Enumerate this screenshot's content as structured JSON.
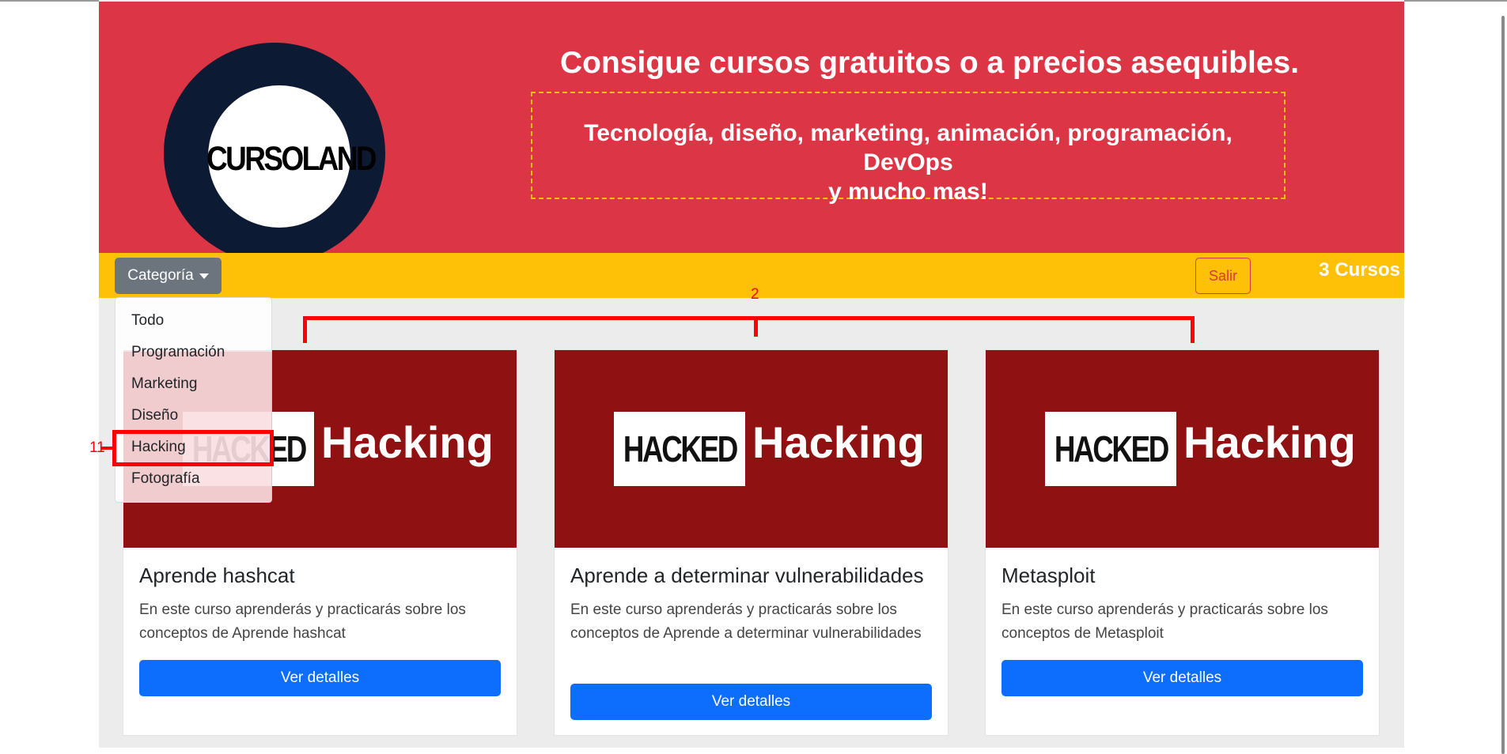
{
  "header": {
    "logo_text": "CURSOLAND",
    "title": "Consigue cursos gratuitos o a precios asequibles.",
    "subtitle_line1": "Tecnología, diseño, marketing, animación, programación, DevOps",
    "subtitle_line2": "y mucho mas!"
  },
  "navbar": {
    "category_label": "Categoría",
    "logout_label": "Salir",
    "count_label": "3 Cursos"
  },
  "dropdown": {
    "items": [
      "Todo",
      "Programación",
      "Marketing",
      "Diseño",
      "Hacking",
      "Fotografía"
    ]
  },
  "cards": [
    {
      "image_text_1": "HACKED",
      "image_text_2": "Hacking",
      "title": "Aprende hashcat",
      "description": "En este curso aprenderás y practicarás sobre los conceptos de Aprende hashcat",
      "button": "Ver detalles"
    },
    {
      "image_text_1": "HACKED",
      "image_text_2": "Hacking",
      "title": "Aprende a determinar vulnerabilidades",
      "description": "En este curso aprenderás y practicarás sobre los conceptos de Aprende a determinar vulnerabilidades",
      "button": "Ver detalles"
    },
    {
      "image_text_1": "HACKED",
      "image_text_2": "Hacking",
      "title": "Metasploit",
      "description": "En este curso aprenderás y practicarás sobre los conceptos de Metasploit",
      "button": "Ver detalles"
    }
  ],
  "annotations": {
    "bracket_label": "2",
    "highlight_label": "11"
  },
  "colors": {
    "hero": "#dc3545",
    "navbar": "#ffc107",
    "primary": "#0d6efd",
    "secondary": "#6c757d",
    "card_image": "#8f1111",
    "logo_ring": "#0c1a33",
    "annotation": "#ff0000"
  }
}
